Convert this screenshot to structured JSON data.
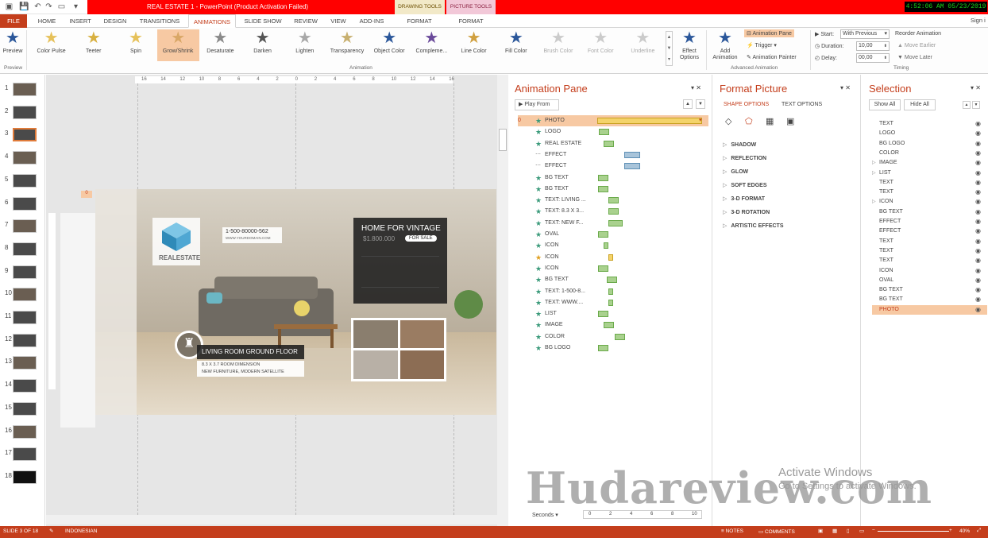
{
  "window": {
    "title": "REAL ESTATE 1 - PowerPoint (Product Activation Failed)",
    "clock": "4:52:06 AM 05/23/2019",
    "context_tabs": [
      "DRAWING TOOLS",
      "PICTURE TOOLS"
    ],
    "sign_in": "Sign i"
  },
  "tabs": [
    "FILE",
    "HOME",
    "INSERT",
    "DESIGN",
    "TRANSITIONS",
    "ANIMATIONS",
    "SLIDE SHOW",
    "REVIEW",
    "VIEW",
    "ADD-INS",
    "FORMAT",
    "FORMAT"
  ],
  "ribbon": {
    "preview_label": "Preview",
    "preview_group": "Preview",
    "animations": [
      "Color Pulse",
      "Teeter",
      "Spin",
      "Grow/Shrink",
      "Desaturate",
      "Darken",
      "Lighten",
      "Transparency",
      "Object Color",
      "Compleme...",
      "Line Color",
      "Fill Color",
      "Brush Color",
      "Font Color",
      "Underline"
    ],
    "selected_animation": "Grow/Shrink",
    "effect_options": "Effect Options",
    "animation_group": "Animation",
    "add_animation": "Add Animation",
    "animation_pane_btn": "Animation Pane",
    "trigger_btn": "Trigger",
    "painter_btn": "Animation Painter",
    "advanced_group": "Advanced Animation",
    "start_label": "Start:",
    "start_value": "With Previous",
    "duration_label": "Duration:",
    "duration_value": "10,00",
    "delay_label": "Delay:",
    "delay_value": "00,00",
    "reorder_label": "Reorder Animation",
    "move_earlier": "Move Earlier",
    "move_later": "Move Later",
    "timing_group": "Timing"
  },
  "thumbnails": [
    "1",
    "2",
    "3",
    "4",
    "5",
    "6",
    "7",
    "8",
    "9",
    "10",
    "11",
    "12",
    "13",
    "14",
    "15",
    "16",
    "17",
    "18"
  ],
  "selected_thumbnail": 3,
  "ruler_ticks": [
    "16",
    "14",
    "12",
    "10",
    "8",
    "6",
    "4",
    "2",
    "0",
    "2",
    "4",
    "6",
    "8",
    "10",
    "12",
    "14",
    "16"
  ],
  "slide": {
    "phone": "1-500-80000-562",
    "website": "WWW.YOURDOMAIN.COM",
    "brand": "REALESTATE",
    "home_title": "HOME FOR VINTAGE",
    "price": "$1.800.000",
    "sale_badge": "FOR SALE",
    "room_title": "LIVING ROOM GROUND FLOOR",
    "room_line1": "8.3 X 3.7 ROOM DIMENSION",
    "room_line2": "NEW FURNITURE, MODERN SATELLITE"
  },
  "animation_pane": {
    "title": "Animation Pane",
    "play_from": "Play From",
    "first_index": "0",
    "items": [
      {
        "name": "PHOTO",
        "icon": "star",
        "bar": "gold"
      },
      {
        "name": "LOGO",
        "icon": "star",
        "bar": "green"
      },
      {
        "name": "REAL ESTATE",
        "icon": "star",
        "bar": "green"
      },
      {
        "name": "EFFECT",
        "icon": "line",
        "bar": "blue"
      },
      {
        "name": "EFFECT",
        "icon": "line",
        "bar": "blue"
      },
      {
        "name": "BG TEXT",
        "icon": "star",
        "bar": "green"
      },
      {
        "name": "BG TEXT",
        "icon": "star",
        "bar": "green"
      },
      {
        "name": "TEXT: LIVING ...",
        "icon": "star",
        "bar": "green"
      },
      {
        "name": "TEXT: 8.3 X 3...",
        "icon": "star",
        "bar": "green"
      },
      {
        "name": "TEXT: NEW F...",
        "icon": "star",
        "bar": "green"
      },
      {
        "name": "OVAL",
        "icon": "star",
        "bar": "green"
      },
      {
        "name": "ICON",
        "icon": "star",
        "bar": "green"
      },
      {
        "name": "ICON",
        "icon": "star-gold",
        "bar": "gold"
      },
      {
        "name": "ICON",
        "icon": "star",
        "bar": "green"
      },
      {
        "name": "BG TEXT",
        "icon": "star",
        "bar": "green"
      },
      {
        "name": "TEXT: 1-500-8...",
        "icon": "star",
        "bar": "green"
      },
      {
        "name": "TEXT: WWW....",
        "icon": "star",
        "bar": "green"
      },
      {
        "name": "LIST",
        "icon": "star",
        "bar": "green"
      },
      {
        "name": "IMAGE",
        "icon": "star",
        "bar": "green"
      },
      {
        "name": "COLOR",
        "icon": "star",
        "bar": "green"
      },
      {
        "name": "BG LOGO",
        "icon": "star",
        "bar": "green"
      }
    ],
    "seconds_label": "Seconds",
    "timeline": [
      "0",
      "2",
      "4",
      "6",
      "8",
      "10"
    ]
  },
  "format_pane": {
    "title": "Format Picture",
    "tab_shape": "SHAPE OPTIONS",
    "tab_text": "TEXT OPTIONS",
    "sections": [
      "SHADOW",
      "REFLECTION",
      "GLOW",
      "SOFT EDGES",
      "3-D FORMAT",
      "3-D ROTATION",
      "ARTISTIC EFFECTS"
    ]
  },
  "selection_pane": {
    "title": "Selection",
    "show_all": "Show All",
    "hide_all": "Hide All",
    "items": [
      "TEXT",
      "LOGO",
      "BG LOGO",
      "COLOR",
      "IMAGE",
      "LIST",
      "TEXT",
      "TEXT",
      "ICON",
      "BG TEXT",
      "EFFECT",
      "EFFECT",
      "TEXT",
      "TEXT",
      "TEXT",
      "ICON",
      "OVAL",
      "BG TEXT",
      "BG TEXT",
      "PHOTO"
    ],
    "expandable": [
      4,
      5,
      8
    ],
    "selected": 19
  },
  "status": {
    "slide_info": "SLIDE 3 OF 18",
    "language": "INDONESIAN",
    "notes": "NOTES",
    "comments": "COMMENTS",
    "zoom": "40%"
  },
  "overlay": {
    "watermark": "Hudareview.com",
    "activate_title": "Activate Windows",
    "activate_sub": "Go to Settings to activate Windows."
  },
  "colors": {
    "accent": "#c43e1c",
    "selected_anim": "#f7c9a3",
    "bar_green": "#a9d18e",
    "bar_blue": "#a8c4da",
    "bar_gold": "#f4d36a"
  }
}
